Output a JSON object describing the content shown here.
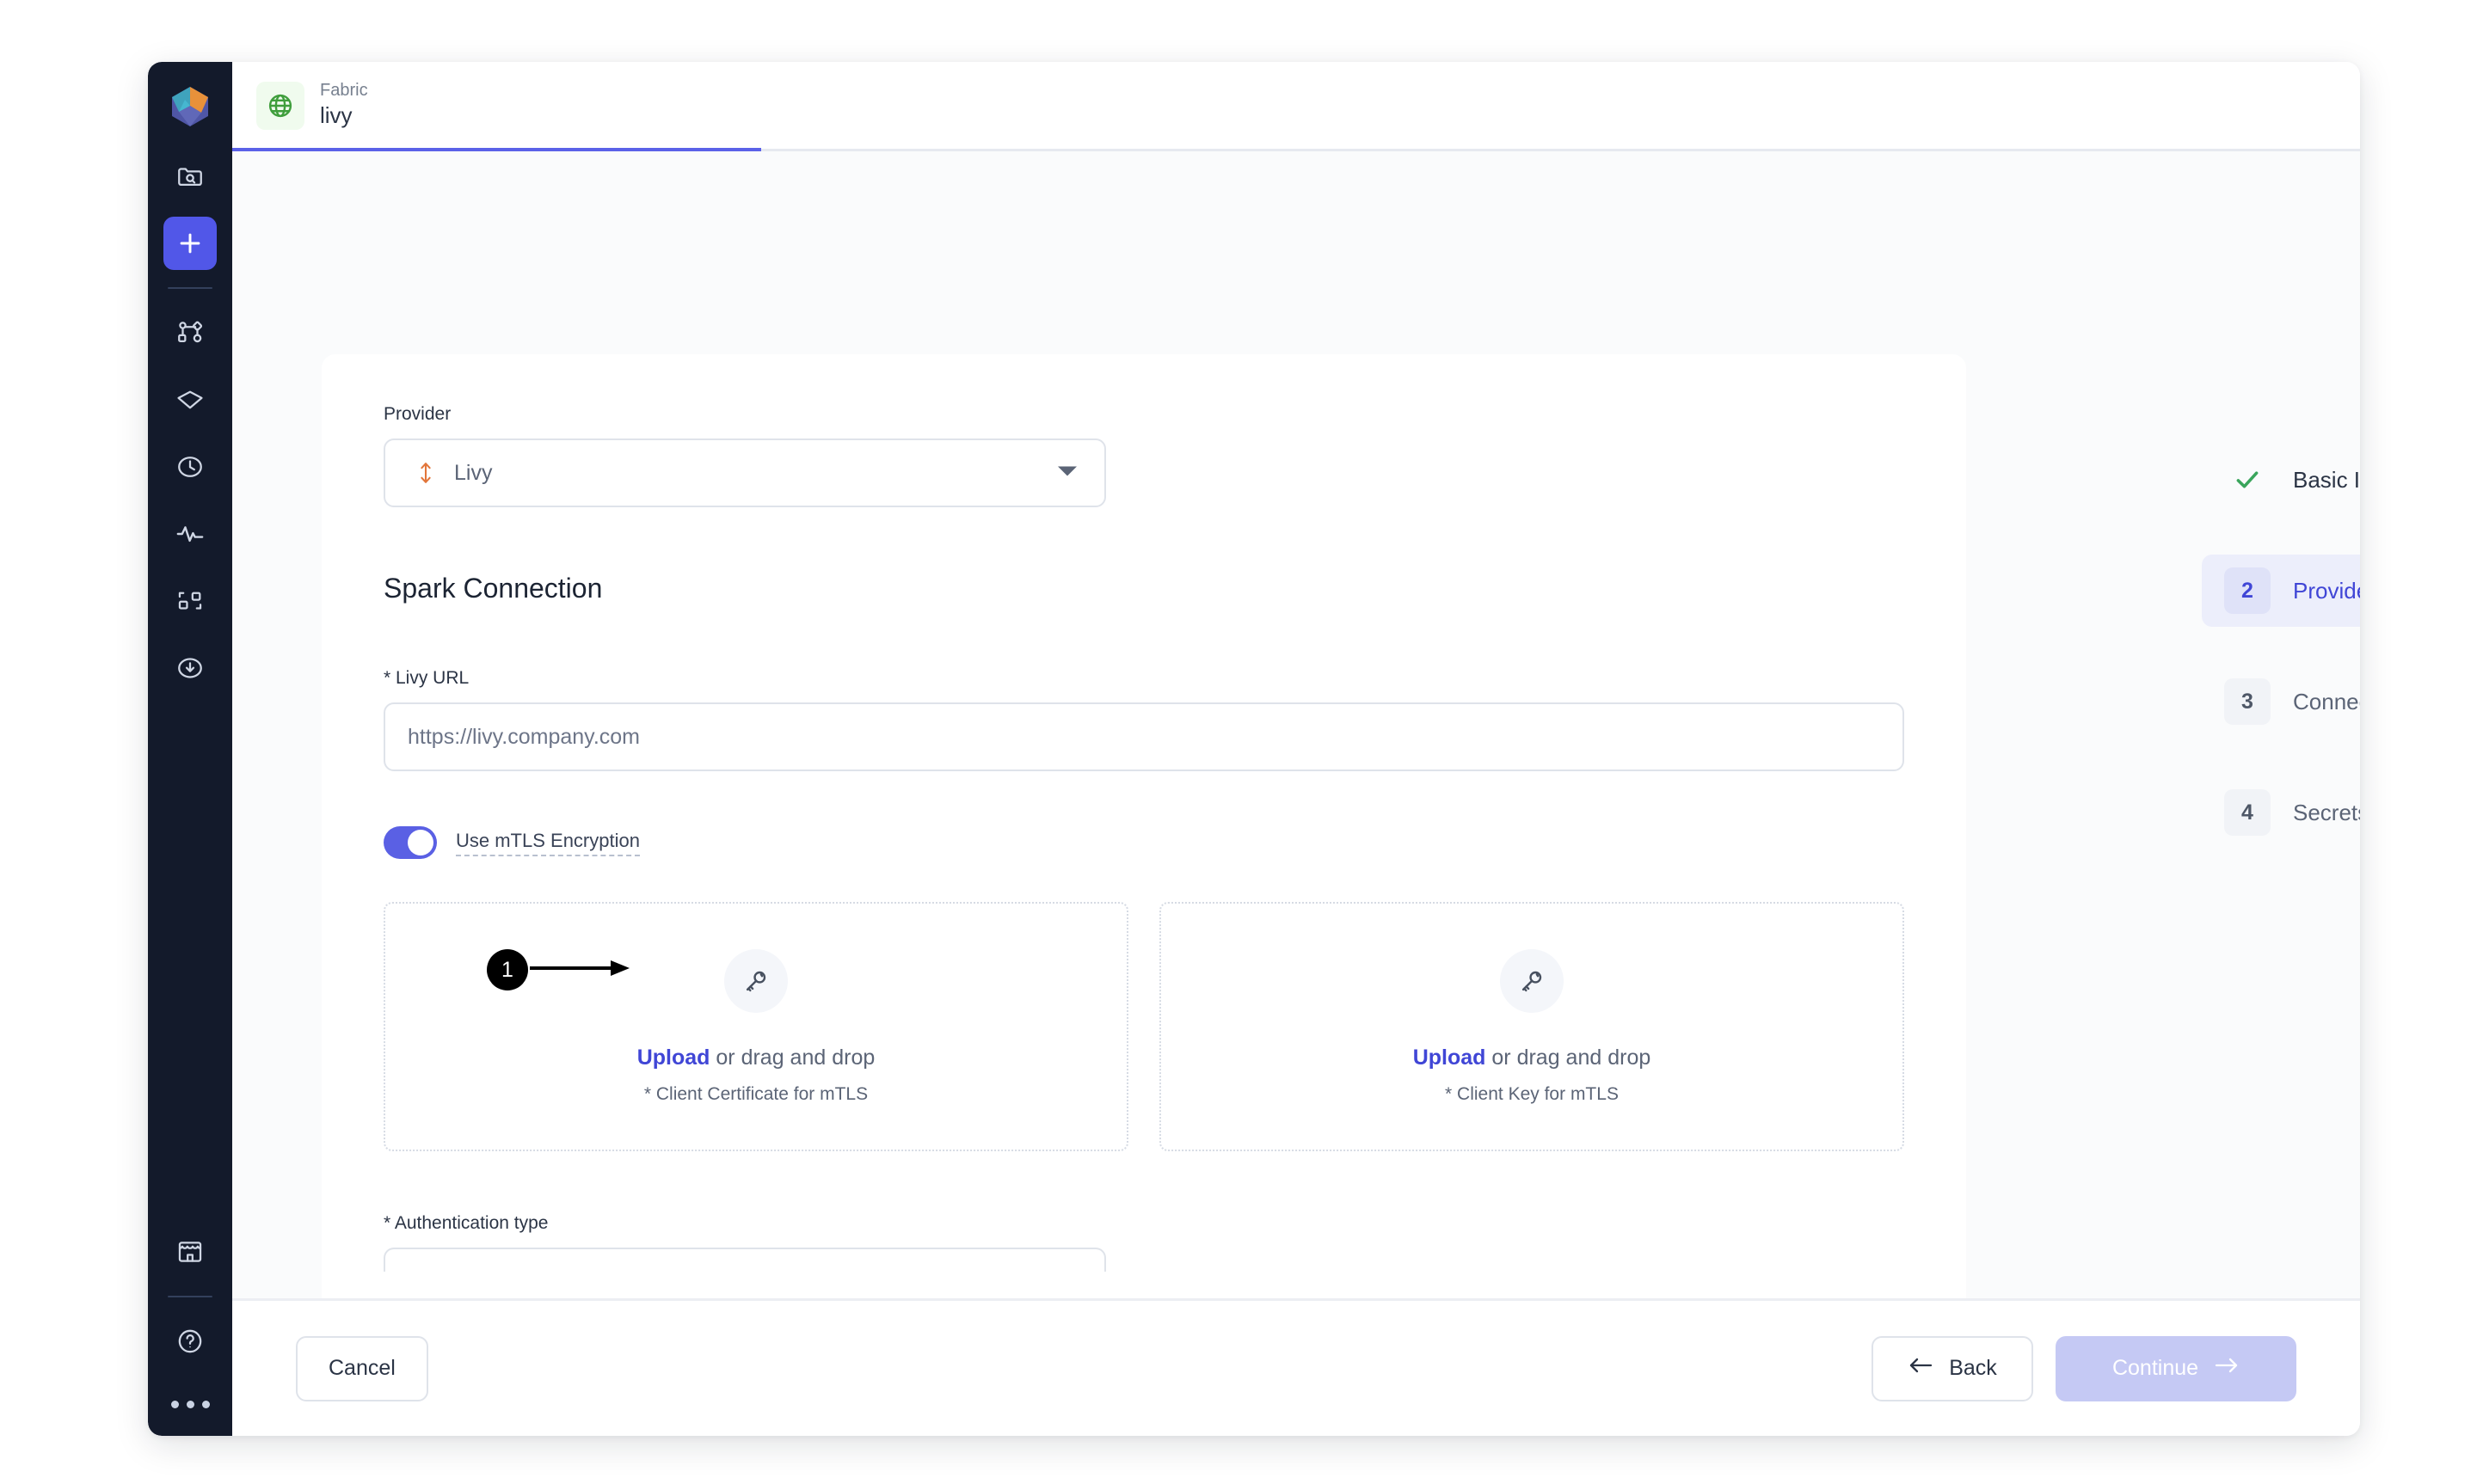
{
  "sidebar": {
    "logo": "fabric-logo",
    "items": [
      {
        "name": "folder-search-icon",
        "label": "Catalog"
      },
      {
        "name": "plus-icon",
        "label": "Add",
        "active": true
      },
      {
        "name": "network-nodes-icon",
        "label": "Pipelines"
      },
      {
        "name": "diamond-icon",
        "label": "Quality"
      },
      {
        "name": "clock-icon",
        "label": "History"
      },
      {
        "name": "activity-pulse-icon",
        "label": "Monitoring"
      },
      {
        "name": "workflow-nodes-icon",
        "label": "Workflows"
      },
      {
        "name": "download-circle-icon",
        "label": "Downloads"
      }
    ],
    "bottom_items": [
      {
        "name": "storefront-icon",
        "label": "Marketplace"
      },
      {
        "name": "help-circle-icon",
        "label": "Help"
      },
      {
        "name": "more-dots-icon",
        "label": "More"
      }
    ]
  },
  "tab": {
    "icon": "globe-icon",
    "kicker": "Fabric",
    "title": "livy"
  },
  "form": {
    "provider_label": "Provider",
    "provider_value": "Livy",
    "provider_icon": "livy-arrows-icon",
    "section_title": "Spark Connection",
    "livy_url_label": "* Livy URL",
    "livy_url_placeholder": "https://livy.company.com",
    "livy_url_value": "",
    "mtls_toggle_label": "Use mTLS Encryption",
    "mtls_toggle_on": true,
    "dropzones": [
      {
        "icon": "key-icon",
        "action": "Upload",
        "rest": " or drag and drop",
        "caption": "* Client Certificate for mTLS"
      },
      {
        "icon": "key-icon",
        "action": "Upload",
        "rest": " or drag and drop",
        "caption": "* Client Key for mTLS"
      }
    ],
    "auth_type_label": "* Authentication type"
  },
  "stepper": [
    {
      "marker": "check",
      "label": "Basic Info",
      "state": "done"
    },
    {
      "marker": "2",
      "label": "Providers",
      "state": "active"
    },
    {
      "marker": "3",
      "label": "Connections",
      "state": "todo"
    },
    {
      "marker": "4",
      "label": "Secrets",
      "state": "todo"
    }
  ],
  "footer": {
    "cancel_label": "Cancel",
    "back_label": "Back",
    "continue_label": "Continue"
  },
  "annotation": {
    "number": "1"
  },
  "colors": {
    "accent_indigo": "#5157e8",
    "accent_blue_link": "#4046d6",
    "rail_dark": "#131a2b",
    "green_check": "#3aa55c",
    "orange_livy": "#e2753a"
  }
}
